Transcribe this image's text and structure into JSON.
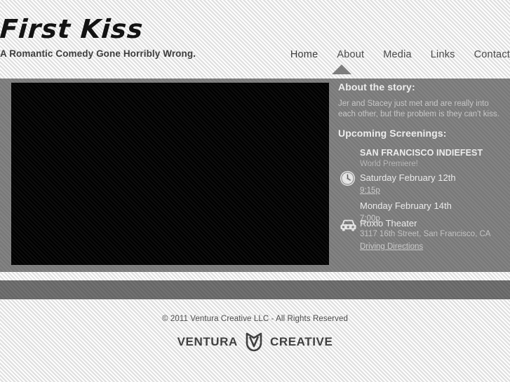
{
  "site": {
    "title": "First Kiss",
    "tagline": "A Romantic Comedy Gone Horribly Wrong."
  },
  "nav": {
    "items": [
      {
        "label": "Home",
        "active": true
      },
      {
        "label": "About",
        "active": false
      },
      {
        "label": "Media",
        "active": false
      },
      {
        "label": "Links",
        "active": false
      },
      {
        "label": "Contact",
        "active": false
      }
    ]
  },
  "media": {
    "player_name": "video-player",
    "state": "black"
  },
  "sidebar": {
    "about_heading": "About the story:",
    "about_text": "Jer and Stacey just met and are really into each other, but the problem is they can't kiss.",
    "screenings_heading": "Upcoming Screenings:",
    "festival": {
      "name": "SAN FRANCISCO INDIEFEST",
      "subtitle": "World Premiere!"
    },
    "clock_icon": "clock-icon",
    "car_icon": "car-icon",
    "showtimes": [
      {
        "date": "Saturday February 12th",
        "time": "9:15p"
      },
      {
        "date": "Monday February 14th",
        "time": "7:00p"
      }
    ],
    "venue": {
      "name": "Roxio Theater",
      "address": "3117 16th Street, San Francisco, CA",
      "directions_label": "Driving Directions"
    }
  },
  "footer": {
    "copyright": "© 2011 Ventura Creative LLC - All Rights Reserved",
    "logo_left": "VENTURA",
    "logo_right": "CREATIVE",
    "logo_mark": "ventura-v-shield-icon"
  },
  "colors": {
    "page_bg": "#ebebeb",
    "panel_gray": "#7d7d7d",
    "dark_band": "#6a6a6a",
    "video_black": "#000000",
    "heading_text": "#f2f2f2",
    "body_text": "#c9c9c9",
    "nav_text": "#4a4a4a",
    "footer_text": "#4d4d4d"
  }
}
